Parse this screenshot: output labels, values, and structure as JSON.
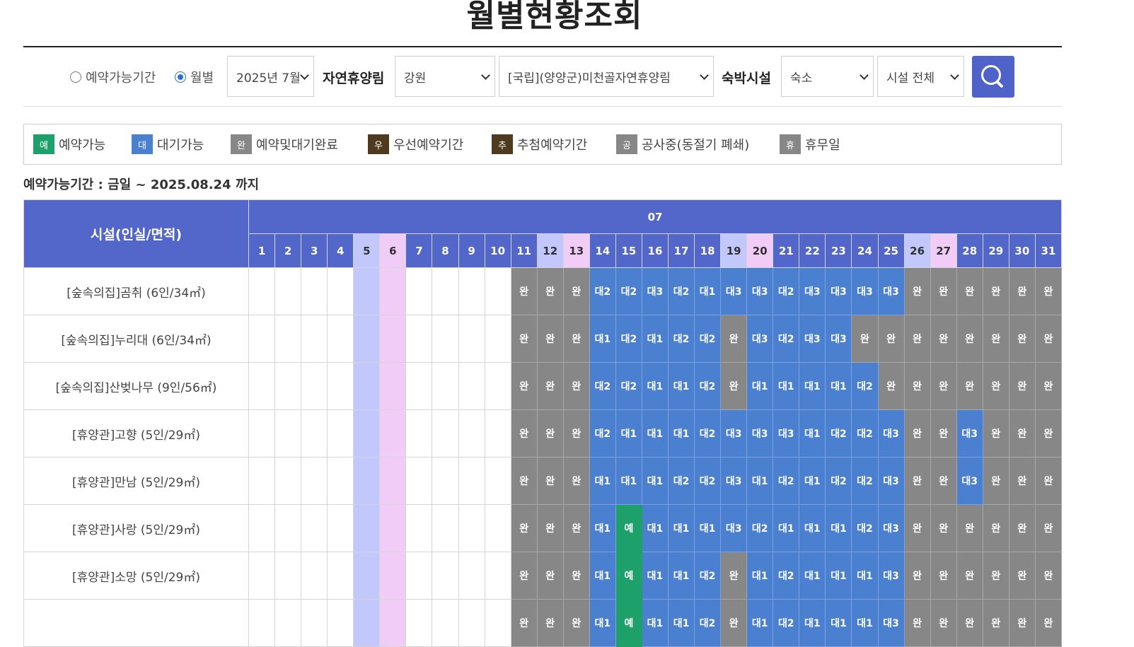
{
  "title": "월별현황조회",
  "search": {
    "radio_period": "예약가능기간",
    "radio_month": "월별",
    "month_select": "2025년 7월",
    "forest_label": "자연휴양림",
    "region_select": "강원",
    "forest_select": "[국립](양양군)미천골자연휴양림",
    "lodging_label": "숙박시설",
    "lodging_type_select": "숙소",
    "facility_select": "시설 전체"
  },
  "legend": [
    {
      "mark": "예",
      "label": "예약가능",
      "color": "#1ea06a"
    },
    {
      "mark": "대",
      "label": "대기가능",
      "color": "#4a80cf"
    },
    {
      "mark": "완",
      "label": "예약및대기완료",
      "color": "#878787"
    },
    {
      "mark": "우",
      "label": "우선예약기간",
      "color": "#4d3a1f"
    },
    {
      "mark": "추",
      "label": "추첨예약기간",
      "color": "#4d3a1f"
    },
    {
      "mark": "공",
      "label": "공사중(동절기 폐쇄)",
      "color": "#878787"
    },
    {
      "mark": "휴",
      "label": "휴무일",
      "color": "#878787"
    }
  ],
  "period_text": "예약가능기간 : 금일 ~ 2025.08.24 까지",
  "table": {
    "facility_header": "시설(인실/면적)",
    "month": "07",
    "days": [
      "1",
      "2",
      "3",
      "4",
      "5",
      "6",
      "7",
      "8",
      "9",
      "10",
      "11",
      "12",
      "13",
      "14",
      "15",
      "16",
      "17",
      "18",
      "19",
      "20",
      "21",
      "22",
      "23",
      "24",
      "25",
      "26",
      "27",
      "28",
      "29",
      "30",
      "31"
    ],
    "saturday_days": [
      "5",
      "12",
      "19",
      "26"
    ],
    "sunday_days": [
      "6",
      "13",
      "20",
      "27"
    ],
    "rows": [
      {
        "name": "[숲속의집]곰취 (6인/34㎡)",
        "cells": [
          "",
          "",
          "",
          "",
          "",
          "",
          "",
          "",
          "",
          "",
          "완",
          "완",
          "완",
          "대2",
          "대2",
          "대3",
          "대2",
          "대1",
          "대3",
          "대3",
          "대2",
          "대3",
          "대3",
          "대3",
          "대3",
          "완",
          "완",
          "완",
          "완",
          "완",
          "완"
        ]
      },
      {
        "name": "[숲속의집]누리대 (6인/34㎡)",
        "cells": [
          "",
          "",
          "",
          "",
          "",
          "",
          "",
          "",
          "",
          "",
          "완",
          "완",
          "완",
          "대1",
          "대2",
          "대1",
          "대2",
          "대2",
          "완",
          "대3",
          "대2",
          "대3",
          "대3",
          "완",
          "완",
          "완",
          "완",
          "완",
          "완",
          "완",
          "완"
        ]
      },
      {
        "name": "[숲속의집]산벚나무 (9인/56㎡)",
        "cells": [
          "",
          "",
          "",
          "",
          "",
          "",
          "",
          "",
          "",
          "",
          "완",
          "완",
          "완",
          "대2",
          "대2",
          "대1",
          "대1",
          "대2",
          "완",
          "대1",
          "대1",
          "대1",
          "대1",
          "대2",
          "완",
          "완",
          "완",
          "완",
          "완",
          "완",
          "완"
        ]
      },
      {
        "name": "[휴양관]고향 (5인/29㎡)",
        "cells": [
          "",
          "",
          "",
          "",
          "",
          "",
          "",
          "",
          "",
          "",
          "완",
          "완",
          "완",
          "대2",
          "대1",
          "대1",
          "대1",
          "대2",
          "대3",
          "대3",
          "대3",
          "대1",
          "대2",
          "대2",
          "대3",
          "완",
          "완",
          "대3",
          "완",
          "완",
          "완"
        ]
      },
      {
        "name": "[휴양관]만남 (5인/29㎡)",
        "cells": [
          "",
          "",
          "",
          "",
          "",
          "",
          "",
          "",
          "",
          "",
          "완",
          "완",
          "완",
          "대1",
          "대1",
          "대1",
          "대2",
          "대2",
          "대3",
          "대1",
          "대2",
          "대1",
          "대2",
          "대2",
          "대3",
          "완",
          "완",
          "대3",
          "완",
          "완",
          "완"
        ]
      },
      {
        "name": "[휴양관]사랑 (5인/29㎡)",
        "cells": [
          "",
          "",
          "",
          "",
          "",
          "",
          "",
          "",
          "",
          "",
          "완",
          "완",
          "완",
          "대1",
          "예",
          "대1",
          "대1",
          "대1",
          "대3",
          "대2",
          "대1",
          "대1",
          "대1",
          "대2",
          "대3",
          "완",
          "완",
          "완",
          "완",
          "완",
          "완"
        ]
      },
      {
        "name": "[휴양관]소망 (5인/29㎡)",
        "cells": [
          "",
          "",
          "",
          "",
          "",
          "",
          "",
          "",
          "",
          "",
          "완",
          "완",
          "완",
          "대1",
          "예",
          "대1",
          "대1",
          "대2",
          "완",
          "대1",
          "대2",
          "대1",
          "대1",
          "대1",
          "대3",
          "완",
          "완",
          "완",
          "완",
          "완",
          "완"
        ]
      },
      {
        "name": "",
        "cells": [
          "",
          "",
          "",
          "",
          "",
          "",
          "",
          "",
          "",
          "",
          "완",
          "완",
          "완",
          "대1",
          "예",
          "대1",
          "대1",
          "대2",
          "완",
          "대1",
          "대2",
          "대1",
          "대1",
          "대1",
          "대3",
          "완",
          "완",
          "완",
          "완",
          "완",
          "완"
        ]
      }
    ]
  }
}
